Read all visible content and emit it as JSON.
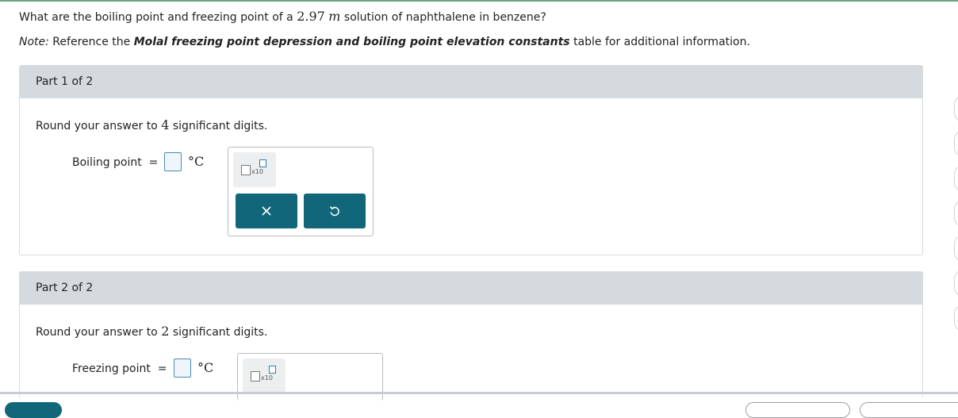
{
  "question": {
    "pre": "What are the boiling point and freezing point of a ",
    "molality": "2.97",
    "unit_var": "m",
    "post": " solution of naphthalene in benzene?"
  },
  "note": {
    "label": "Note:",
    "pre": " Reference the ",
    "bold": "Molal freezing point depression and boiling point elevation constants",
    "post": " table for additional information."
  },
  "parts": [
    {
      "header": "Part 1 of 2",
      "round_pre": "Round your answer to ",
      "sig": "4",
      "round_post": " significant digits.",
      "label": "Boiling point",
      "equals": "=",
      "unit": "°C",
      "x10": "x10"
    },
    {
      "header": "Part 2 of 2",
      "round_pre": "Round your answer to ",
      "sig": "2",
      "round_post": " significant digits.",
      "label": "Freezing point",
      "equals": "=",
      "unit": "°C",
      "x10": "x10"
    }
  ],
  "colors": {
    "accent": "#116779",
    "header_bg": "#d4dadd",
    "input_border": "#4a8ab0"
  },
  "icons": {
    "clear": "close-icon",
    "undo": "undo-icon"
  }
}
